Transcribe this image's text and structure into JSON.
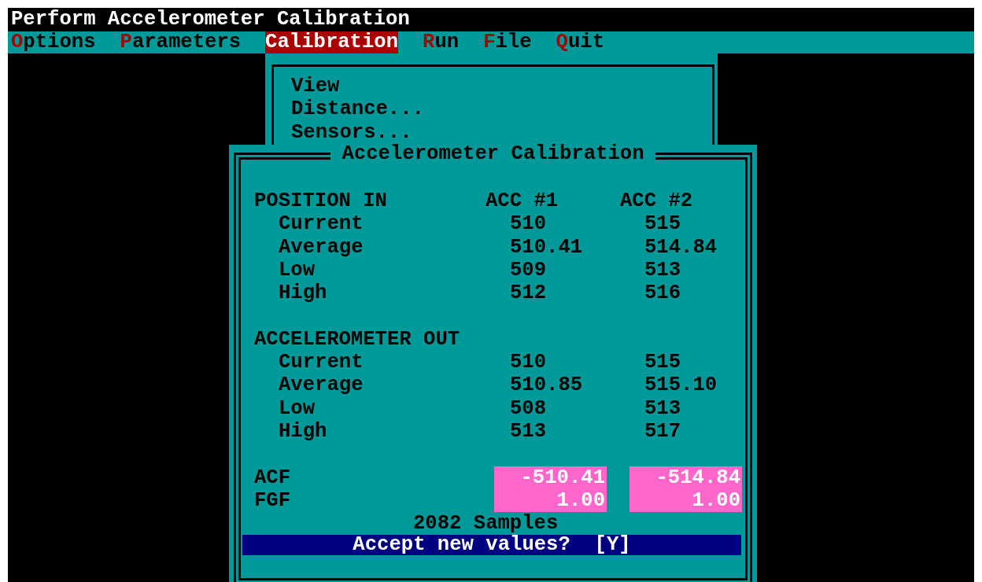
{
  "title": "Perform Accelerometer Calibration",
  "menu": [
    {
      "label": "Options",
      "selected": false
    },
    {
      "label": "Parameters",
      "selected": false
    },
    {
      "label": "Calibration",
      "selected": true
    },
    {
      "label": "Run",
      "selected": false
    },
    {
      "label": "File",
      "selected": false
    },
    {
      "label": "Quit",
      "selected": false
    }
  ],
  "dropdown": {
    "items": [
      "View",
      "Distance...",
      "Sensors..."
    ]
  },
  "dialog": {
    "title": "Accelerometer Calibration",
    "sections": [
      {
        "heading": "POSITION IN",
        "columns": [
          "ACC #1",
          "ACC #2"
        ],
        "rows": [
          {
            "label": "Current",
            "values": [
              "510",
              "515"
            ]
          },
          {
            "label": "Average",
            "values": [
              "510.41",
              "514.84"
            ]
          },
          {
            "label": "Low",
            "values": [
              "509",
              "513"
            ]
          },
          {
            "label": "High",
            "values": [
              "512",
              "516"
            ]
          }
        ]
      },
      {
        "heading": "ACCELEROMETER OUT",
        "rows": [
          {
            "label": "Current",
            "values": [
              "510",
              "515"
            ]
          },
          {
            "label": "Average",
            "values": [
              "510.85",
              "515.10"
            ]
          },
          {
            "label": "Low",
            "values": [
              "508",
              "513"
            ]
          },
          {
            "label": "High",
            "values": [
              "513",
              "517"
            ]
          }
        ]
      }
    ],
    "factors": [
      {
        "label": "ACF",
        "values": [
          "-510.41",
          "-514.84"
        ]
      },
      {
        "label": "FGF",
        "values": [
          "1.00",
          "1.00"
        ]
      }
    ],
    "samples": "2082 Samples",
    "prompt": "Accept new values?  [Y]"
  }
}
